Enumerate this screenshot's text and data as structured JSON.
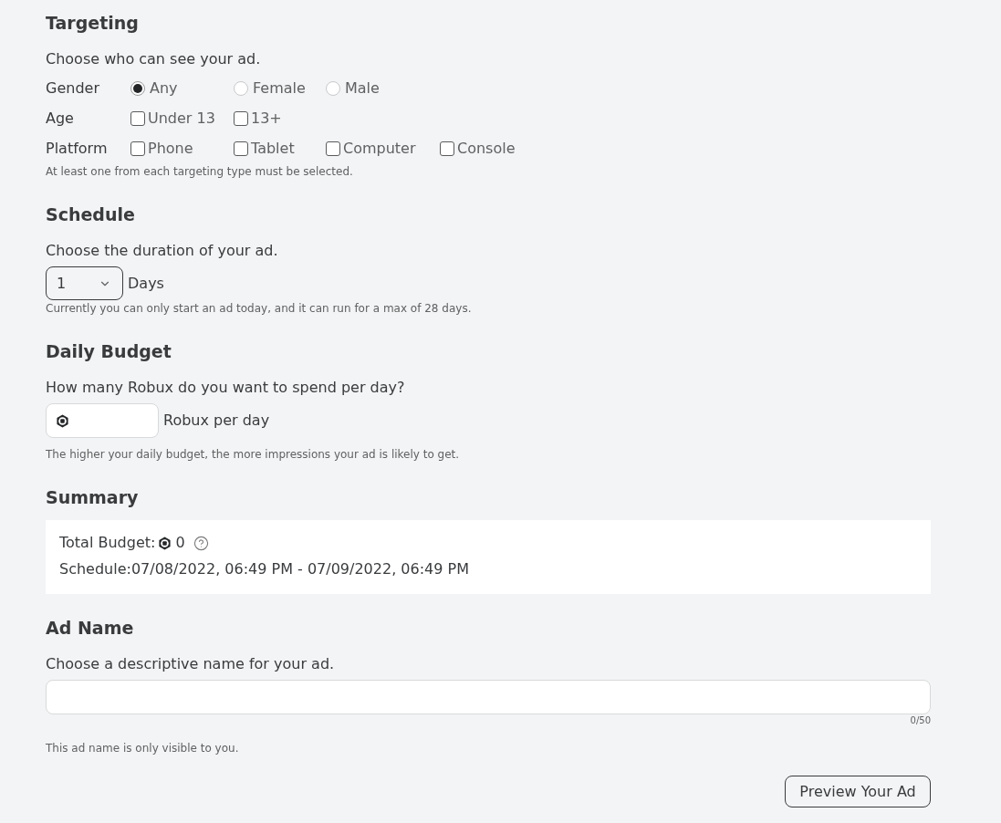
{
  "targeting": {
    "title": "Targeting",
    "prompt": "Choose who can see your ad.",
    "groups": [
      {
        "label": "Gender",
        "kind": "radio",
        "options": [
          {
            "label": "Any",
            "selected": true
          },
          {
            "label": "Female",
            "selected": false
          },
          {
            "label": "Male",
            "selected": false
          }
        ]
      },
      {
        "label": "Age",
        "kind": "checkbox",
        "options": [
          {
            "label": "Under 13",
            "checked": false
          },
          {
            "label": "13+",
            "checked": false
          }
        ]
      },
      {
        "label": "Platform",
        "kind": "checkbox",
        "options": [
          {
            "label": "Phone",
            "checked": false
          },
          {
            "label": "Tablet",
            "checked": false
          },
          {
            "label": "Computer",
            "checked": false
          },
          {
            "label": "Console",
            "checked": false
          }
        ]
      }
    ],
    "note": "At least one from each targeting type must be selected."
  },
  "schedule": {
    "title": "Schedule",
    "prompt": "Choose the duration of your ad.",
    "duration": "1",
    "unit": "Days",
    "note": "Currently you can only start an ad today, and it can run for a max of 28 days."
  },
  "daily_budget": {
    "title": "Daily Budget",
    "prompt": "How many Robux do you want to spend per day?",
    "unit": "Robux per day",
    "note": "The higher your daily budget, the more impressions your ad is likely to get."
  },
  "summary": {
    "title": "Summary",
    "rows": [
      {
        "kind": "budget",
        "label": "Total Budget:",
        "value": "0"
      },
      {
        "kind": "schedule",
        "label": "Schedule:",
        "value": "07/08/2022, 06:49 PM - 07/09/2022, 06:49 PM"
      }
    ]
  },
  "ad_name": {
    "title": "Ad Name",
    "prompt": "Choose a descriptive name for your ad.",
    "counter": "0/50",
    "note": "This ad name is only visible to you."
  },
  "preview_button": {
    "label": "Preview Your Ad"
  }
}
